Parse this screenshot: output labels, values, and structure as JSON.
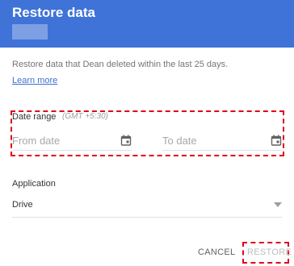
{
  "dialog": {
    "title": "Restore data",
    "description": "Restore data that Dean deleted within the last 25 days.",
    "learn_more": "Learn more"
  },
  "date_range": {
    "label": "Date range",
    "timezone": "(GMT +5:30)",
    "from_placeholder": "From date",
    "to_placeholder": "To date",
    "icon": "calendar-icon"
  },
  "application": {
    "label": "Application",
    "value": "Drive",
    "icon": "dropdown-arrow-icon"
  },
  "actions": {
    "cancel": "CANCEL",
    "restore": "RESTORE"
  },
  "colors": {
    "header": "#3f73d8",
    "link": "#3f6fd1",
    "highlight": "#e0001a"
  }
}
